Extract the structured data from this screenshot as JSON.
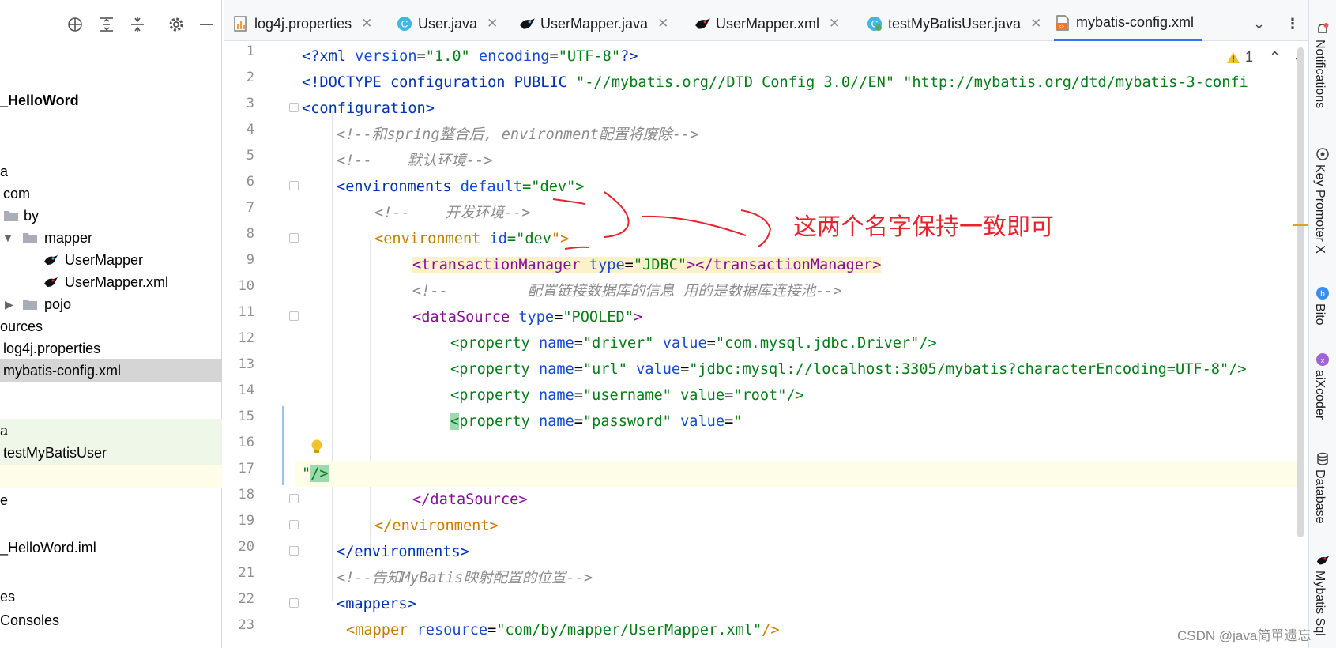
{
  "project_panel": {
    "toolbar_icons": [
      "crosshair-icon",
      "expand-all-icon",
      "collapse-all-icon",
      "gear-icon",
      "minimize-icon"
    ],
    "items": [
      {
        "label": "_HelloWord",
        "bold": true
      },
      {
        "label": "a"
      },
      {
        "label": "com"
      },
      {
        "label": "by"
      },
      {
        "label": "mapper"
      },
      {
        "label": "UserMapper"
      },
      {
        "label": "UserMapper.xml"
      },
      {
        "label": "pojo"
      },
      {
        "label": "ources"
      },
      {
        "label": "log4j.properties"
      },
      {
        "label": "mybatis-config.xml"
      },
      {
        "label": "a"
      },
      {
        "label": "testMyBatisUser"
      },
      {
        "label": "e"
      },
      {
        "label": "_HelloWord.iml"
      },
      {
        "label": "es"
      },
      {
        "label": "Consoles"
      }
    ]
  },
  "tabs": [
    {
      "label": "log4j.properties"
    },
    {
      "label": "User.java"
    },
    {
      "label": "UserMapper.java"
    },
    {
      "label": "UserMapper.xml"
    },
    {
      "label": "testMyBatisUser.java"
    },
    {
      "label": "mybatis-config.xml",
      "active": true
    }
  ],
  "editor": {
    "line_numbers": [
      "1",
      "2",
      "3",
      "4",
      "5",
      "6",
      "7",
      "8",
      "9",
      "10",
      "11",
      "12",
      "13",
      "14",
      "15",
      "16",
      "17",
      "18",
      "19",
      "20",
      "21",
      "22",
      "23"
    ],
    "warning_count": "1",
    "lines": {
      "l1": {
        "a": "<?xml ",
        "b": "version",
        "c": "=",
        "d": "\"1.0\"",
        "e": " encoding",
        "f": "=",
        "g": "\"UTF-8\"",
        "h": "?>"
      },
      "l2": {
        "a": "<!DOCTYPE ",
        "b": "configuration PUBLIC ",
        "c": "\"-//mybatis.org//DTD Config 3.0//EN\" \"http://mybatis.org/dtd/mybatis-3-confi"
      },
      "l3": {
        "a": "<configuration>"
      },
      "l4": {
        "a": "<!--和spring整合后, environment配置将废除-->"
      },
      "l5": {
        "a": "<!--    默认环境-->"
      },
      "l6": {
        "a": "<environments ",
        "b": "default",
        "c": "=\"",
        "d": "dev",
        "e": "\">"
      },
      "l7": {
        "a": "<!--    开发环境-->"
      },
      "l8": {
        "a": "<environment ",
        "b": "id",
        "c": "=\"",
        "d": "dev",
        "e": "\">"
      },
      "l9": {
        "a": "<transactionManager ",
        "b": "type",
        "c": "=",
        "d": "\"JDBC\"",
        "e": "></transactionManager>"
      },
      "l10": {
        "a": "<!--         配置链接数据库的信息 用的是数据库连接池-->"
      },
      "l11": {
        "a": "<dataSource ",
        "b": "type",
        "c": "=",
        "d": "\"POOLED\"",
        "e": ">"
      },
      "l12": {
        "a": "<property ",
        "b": "name",
        "c": "=",
        "d": "\"driver\"",
        "e": " value",
        "f": "=",
        "g": "\"com.mysql.jdbc.Driver\"",
        "h": "/>"
      },
      "l13": {
        "a": "<property ",
        "b": "name",
        "c": "=",
        "d": "\"url\"",
        "e": " value",
        "f": "=",
        "g": "\"jdbc:mysql://localhost:3305/mybatis?characterEncoding=UTF-8\"",
        "h": "/>"
      },
      "l14": {
        "a": "<property ",
        "b": "name",
        "c": "=",
        "d": "\"username\"",
        "e": " value",
        "f": "=",
        "g": "\"root\"",
        "h": "/>"
      },
      "l15": {
        "a": "<",
        "b": "property ",
        "c": "name",
        "d": "=",
        "e": "\"password\"",
        "f": " value",
        "g": "=",
        "h": "\""
      },
      "l17": {
        "a": "\"",
        "b": "/>"
      },
      "l18": {
        "a": "</dataSource>"
      },
      "l19": {
        "a": "</environment>"
      },
      "l20": {
        "a": "</environments>"
      },
      "l21": {
        "a": "<!--告知MyBatis映射配置的位置-->"
      },
      "l22": {
        "a": "<mappers>"
      },
      "l23": {
        "a": "<mapper ",
        "b": "resource",
        "c": "=",
        "d": "\"com/by/mapper/UserMapper.xml\"",
        "e": "/>"
      }
    }
  },
  "annotation": "这两个名字保持一致即可",
  "watermark": "CSDN @java简單遗忘",
  "right_tools": [
    {
      "label": "Notifications",
      "icon": "bell-icon"
    },
    {
      "label": "Key Promoter X",
      "icon": "key-promoter-icon"
    },
    {
      "label": "Bito",
      "icon": "bito-icon"
    },
    {
      "label": "aiXcoder",
      "icon": "aixcoder-icon"
    },
    {
      "label": "Database",
      "icon": "database-icon"
    },
    {
      "label": "Mybatis Sql",
      "icon": "mybatis-bird-icon"
    }
  ],
  "colors": {
    "active_tab": "#3574f0",
    "annotation": "#e8222e",
    "selection": "#d5d5d5"
  }
}
